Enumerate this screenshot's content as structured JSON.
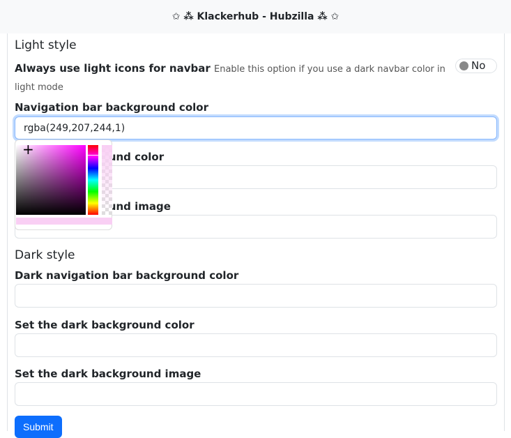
{
  "header": {
    "title": "✩ ⁂ Klackerhub - Hubzilla ⁂ ✩"
  },
  "light": {
    "heading": "Light style",
    "light_icons_label": "Always use light icons for navbar",
    "light_icons_help": "Enable this option if you use a dark navbar color in light mode",
    "light_icons_value": "No",
    "nav_bg_label": "Navigation bar background color",
    "nav_bg_value": "rgba(249,207,244,1)",
    "bg_color_label": "Set the background color",
    "bg_image_label": "Set the background image"
  },
  "dark": {
    "heading": "Dark style",
    "nav_bg_label": "Dark navigation bar background color",
    "bg_color_label": "Set the dark background color",
    "bg_image_label": "Set the dark background image"
  },
  "submit_label": "Submit",
  "picker_color": "#f9cff4"
}
